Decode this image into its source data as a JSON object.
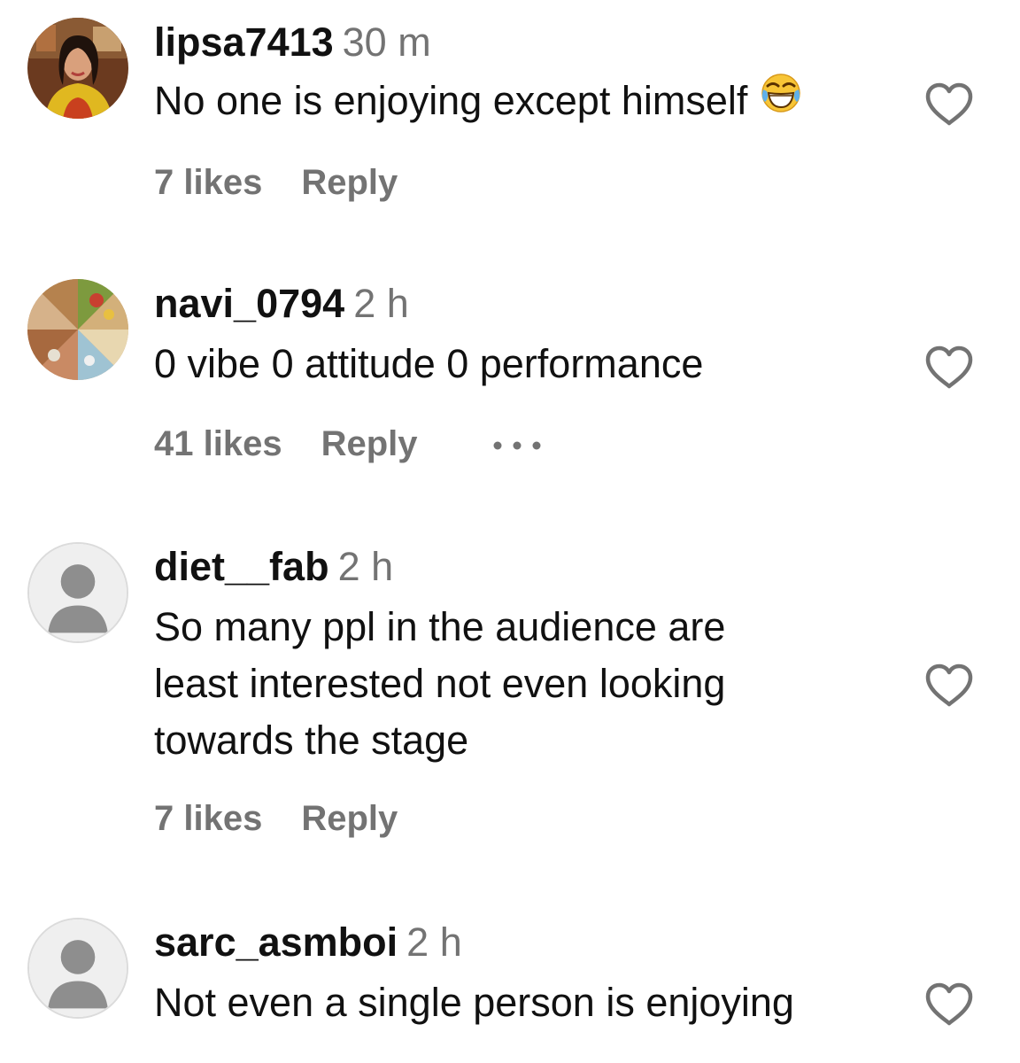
{
  "comments": [
    {
      "username": "lipsa7413",
      "time": "30 m",
      "text_lines": [
        "No one is enjoying except himself"
      ],
      "emoji": "joy-emoji",
      "likes": "7 likes",
      "reply": "Reply",
      "avatar": "user-photo"
    },
    {
      "username": "navi_0794",
      "time": "2 h",
      "text_lines": [
        "0 vibe 0 attitude 0 performance"
      ],
      "likes": "41 likes",
      "reply": "Reply",
      "more": "more-options-icon",
      "avatar": "collage-photo"
    },
    {
      "username": "diet__fab",
      "time": "2 h",
      "text_lines": [
        "So many ppl in the audience are",
        "least interested not even looking",
        "towards the stage"
      ],
      "likes": "7 likes",
      "reply": "Reply",
      "avatar": "default-avatar"
    },
    {
      "username": "sarc_asmboi",
      "time": "2 h",
      "text_lines": [
        "Not even a single person is enjoying"
      ],
      "avatar": "default-avatar"
    }
  ],
  "colors": {
    "username": "#111111",
    "secondary_text": "#737373",
    "heart_stroke": "#737373",
    "default_avatar_bg": "#efefef",
    "default_avatar_figure": "#8e8e8e"
  }
}
